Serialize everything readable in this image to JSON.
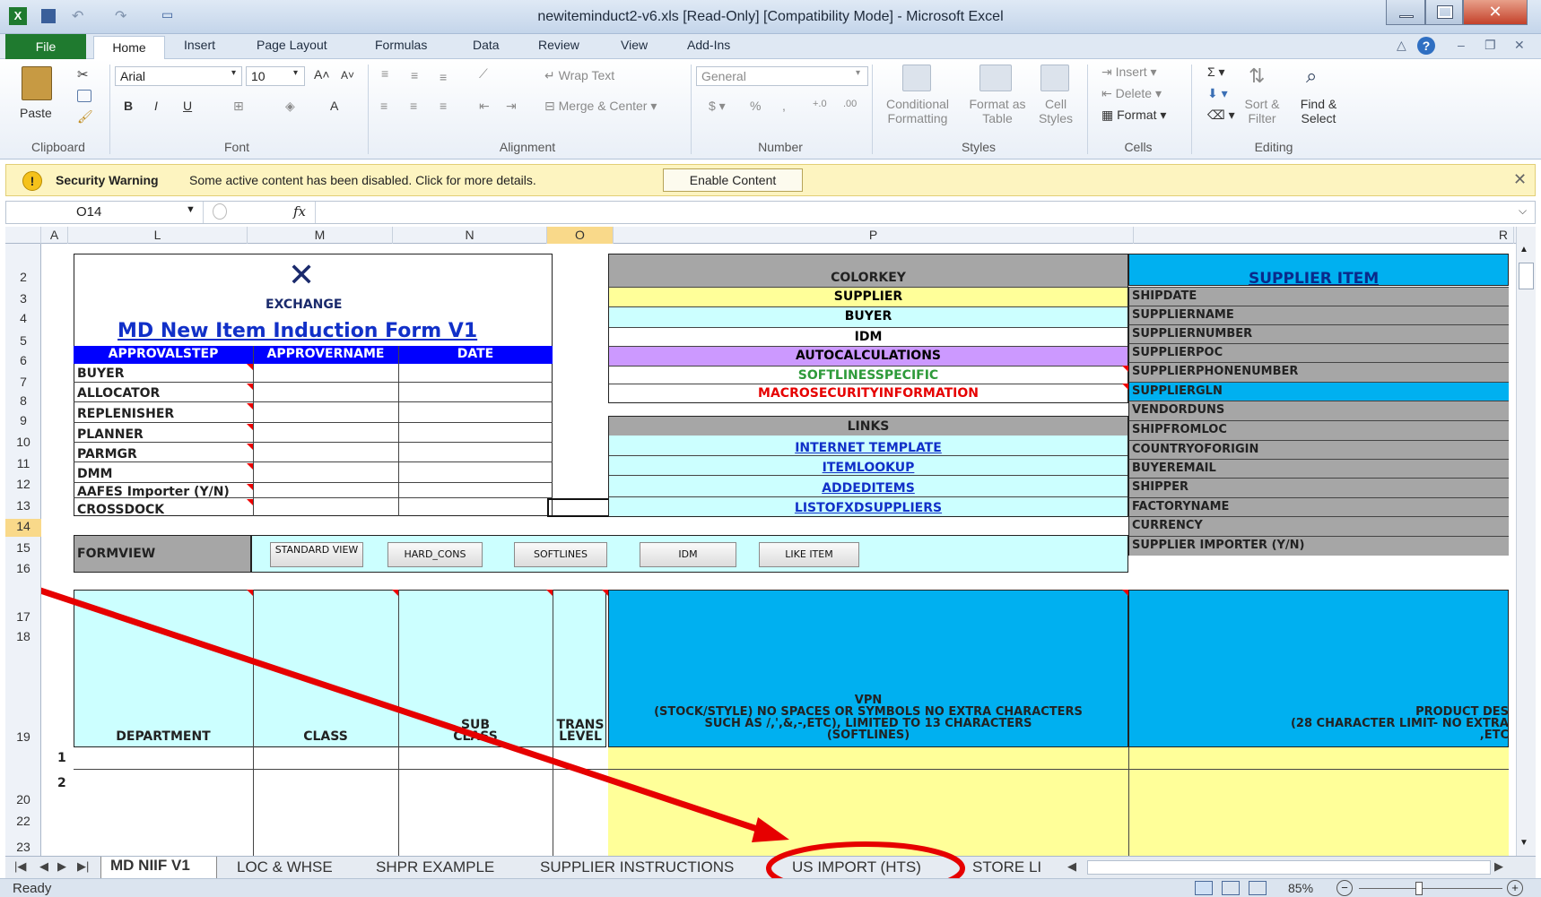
{
  "window": {
    "title": "newiteminduct2-v6.xls  [Read-Only]  [Compatibility Mode]  -  Microsoft Excel"
  },
  "menu": {
    "tabs": [
      "File",
      "Home",
      "Insert",
      "Page Layout",
      "Formulas",
      "Data",
      "Review",
      "View",
      "Add-Ins"
    ]
  },
  "ribbon": {
    "font_name": "Arial",
    "font_size": "10",
    "paste": "Paste",
    "wrap_text": "Wrap Text",
    "merge_center": "Merge & Center",
    "number_format": "General",
    "conditional_1": "Conditional",
    "conditional_2": "Formatting",
    "format_as_1": "Format as",
    "format_as_2": "Table",
    "cell_styles_1": "Cell",
    "cell_styles_2": "Styles",
    "insert": "Insert",
    "delete": "Delete",
    "format": "Format",
    "sort_1": "Sort &",
    "sort_2": "Filter",
    "find_1": "Find &",
    "find_2": "Select",
    "groups": {
      "clipboard": "Clipboard",
      "font": "Font",
      "alignment": "Alignment",
      "number": "Number",
      "styles": "Styles",
      "cells": "Cells",
      "editing": "Editing"
    }
  },
  "security": {
    "title": "Security Warning",
    "message": "Some active content has been disabled. Click for more details.",
    "button": "Enable Content"
  },
  "formula_bar": {
    "name_box": "O14",
    "fx": "fx",
    "value": ""
  },
  "columns": [
    "A",
    "L",
    "M",
    "N",
    "O",
    "P",
    "R"
  ],
  "rows": [
    "2",
    "3",
    "4",
    "5",
    "6",
    "7",
    "8",
    "9",
    "10",
    "11",
    "12",
    "13",
    "14",
    "15",
    "16",
    "17",
    "18",
    "19",
    "20",
    "22",
    "23"
  ],
  "form": {
    "logo_text": "EXCHANGE",
    "title": "MD New Item Induction Form V1",
    "headers": [
      "APPROVALSTEP",
      "APPROVERNAME",
      "DATE"
    ],
    "steps": [
      "BUYER",
      "ALLOCATOR",
      "REPLENISHER",
      "PLANNER",
      "PARMGR",
      "DMM",
      "AAFES Importer  (Y/N)",
      "CROSSDOCK"
    ],
    "formview_label": "FORMVIEW",
    "formview_buttons": [
      "STANDARD VIEW",
      "HARD_CONS",
      "SOFTLINES",
      "IDM",
      "LIKE ITEM"
    ]
  },
  "colorkey": {
    "header": "COLORKEY",
    "items": [
      {
        "label": "SUPPLIER",
        "bg": "#ffff99",
        "color": "#000000"
      },
      {
        "label": "BUYER",
        "bg": "#ccffff",
        "color": "#000000"
      },
      {
        "label": "IDM",
        "bg": "#ffffff",
        "color": "#000000"
      },
      {
        "label": "AUTOCALCULATIONS",
        "bg": "#cc99ff",
        "color": "#000000"
      },
      {
        "label": "SOFTLINESSPECIFIC",
        "bg": "#ffffff",
        "color": "#2e9a3a"
      },
      {
        "label": "MACROSECURITYINFORMATION",
        "bg": "#ffffff",
        "color": "#e60000"
      }
    ],
    "links_header": "LINKS",
    "links": [
      "INTERNET TEMPLATE",
      "ITEMLOOKUP",
      "ADDEDITEMS",
      "LISTOFXDSUPPLIERS"
    ]
  },
  "supplier": {
    "header": "SUPPLIER ITEM",
    "fields": [
      "SHIPDATE",
      "SUPPLIERNAME",
      "SUPPLIERNUMBER",
      "SUPPLIERPOC",
      "SUPPLIERPHONENUMBER",
      "SUPPLIERGLN",
      "VENDORDUNS",
      "SHIPFROMLOC",
      "COUNTRYOFORIGIN",
      "BUYEREMAIL",
      "SHIPPER",
      "FACTORYNAME",
      "CURRENCY",
      "SUPPLIER IMPORTER  (Y/N)"
    ]
  },
  "table_header": {
    "department": "DEPARTMENT",
    "class": "CLASS",
    "sub_class_1": "SUB",
    "sub_class_2": "CLASS",
    "trans_1": "TRANS",
    "trans_2": "LEVEL",
    "vpn_1": "VPN",
    "vpn_2": "(STOCK/STYLE) NO SPACES OR SYMBOLS NO EXTRA CHARACTERS",
    "vpn_3": "SUCH AS /,',&,-,ETC), LIMITED TO 13 CHARACTERS",
    "vpn_4": "(SOFTLINES)",
    "prod_1": "PRODUCT DES",
    "prod_2": "(28 CHARACTER LIMIT- NO EXTRA",
    "prod_3": ",ETC"
  },
  "row_numbers": [
    "1",
    "2"
  ],
  "sheet_tabs": [
    "MD NIIF V1",
    "LOC & WHSE",
    "SHPR EXAMPLE",
    "SUPPLIER INSTRUCTIONS",
    "US IMPORT (HTS)",
    "STORE LI"
  ],
  "status": {
    "ready": "Ready",
    "zoom": "85%"
  },
  "colors": {
    "blue_header": "#0000ff",
    "cyan": "#ccffff",
    "sky": "#00b0f0",
    "gray_header": "#a6a6a6",
    "yellow": "#ffff99",
    "annotation_red": "#e60000"
  }
}
